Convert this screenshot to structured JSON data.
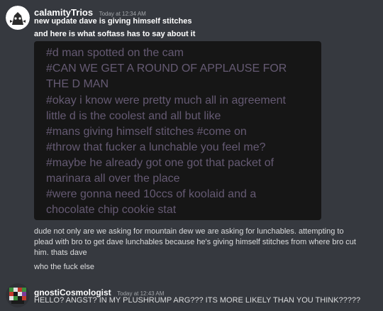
{
  "messages": [
    {
      "username": "calamityTrios",
      "timestamp": "Today at 12:34 AM",
      "lines": [
        "new update dave is giving himself stitches",
        "and here is what softass has to say about it"
      ],
      "image_tags": [
        "#d man spotted on the cam",
        "#CAN WE GET A ROUND OF APPLAUSE FOR",
        "THE D MAN",
        "#okay i know were pretty much all in agreement",
        "little d is the coolest and all but like",
        "#mans giving himself stitches   #come on",
        "#throw that fucker a lunchable you feel me?",
        "#maybe he already got one got that packet of",
        "marinara all over the place",
        "#were gonna need 10ccs of koolaid and a",
        "chocolate chip cookie stat"
      ],
      "followups": [
        "dude not only are we asking for mountain dew we are asking for lunchables. attempting to",
        "plead with bro to get dave lunchables because he's giving himself stitches from where bro cut",
        "him. thats dave",
        "who the fuck else"
      ]
    },
    {
      "username": "gnostiCosmologist",
      "timestamp": "Today at 12:43 AM",
      "lines": [
        "HELLO? ANGST? IN MY PLUSHRUMP ARG??? ITS MORE LIKELY THAN YOU THINK?????"
      ]
    }
  ],
  "colors": {
    "background": "#36393f",
    "embed_bg": "#161616",
    "tag_text": "#655a73",
    "username": "#ffffff",
    "timestamp": "#a3a6aa"
  }
}
